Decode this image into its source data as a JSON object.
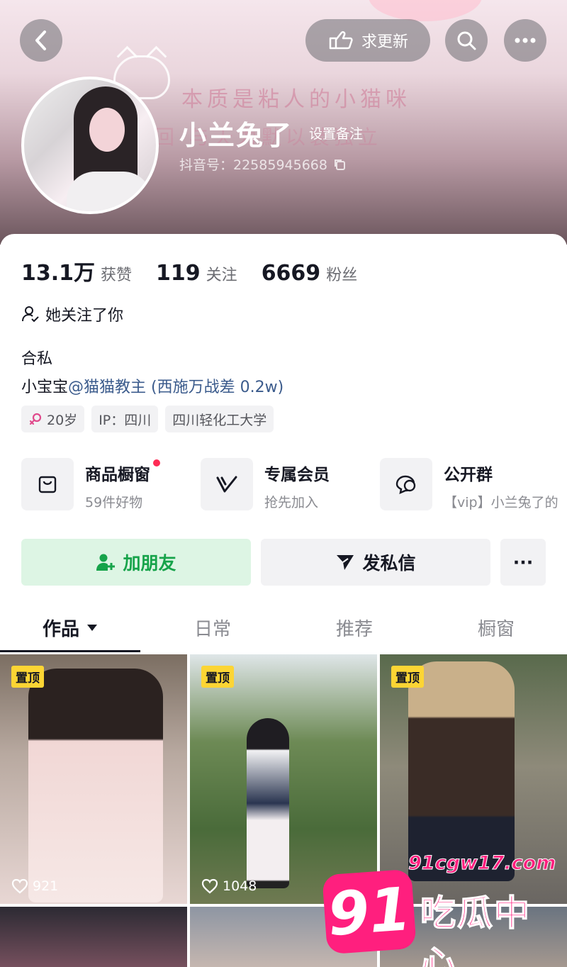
{
  "header": {
    "request_update_label": "求更新",
    "nickname": "小兰兔了",
    "remark_label": "设置备注",
    "douyin_id": "抖音号：22585945668",
    "banner_text_line1": "本质是粘人的小猫咪",
    "banner_text_line2": "回 与天为默以装独立"
  },
  "stats": [
    {
      "value": "13.1万",
      "label": "获赞"
    },
    {
      "value": "119",
      "label": "关注"
    },
    {
      "value": "6669",
      "label": "粉丝"
    }
  ],
  "profile": {
    "follows_you": "她关注了你",
    "bio_line1": "合私",
    "bio_line2_prefix": "小宝宝",
    "bio_line2_mention": "@猫猫教主 (西施万战差 0.2w)",
    "tags": [
      "20岁",
      "IP：四川",
      "四川轻化工大学"
    ]
  },
  "features": [
    {
      "title": "商品橱窗",
      "sub": "59件好物",
      "icon": "shop-bag-icon"
    },
    {
      "title": "专属会员",
      "sub": "抢先加入",
      "icon": "vip-v-icon"
    },
    {
      "title": "公开群",
      "sub": "【vip】小兰兔了的",
      "icon": "chat-bubbles-icon"
    }
  ],
  "actions": {
    "add_friend": "加朋友",
    "message": "发私信",
    "more": "···"
  },
  "tabs": [
    "作品",
    "日常",
    "推荐",
    "橱窗"
  ],
  "videos": [
    {
      "pinned": "置顶",
      "likes": "921"
    },
    {
      "pinned": "置顶",
      "likes": "1048"
    },
    {
      "pinned": "置顶",
      "likes": ""
    }
  ],
  "watermark": {
    "logo": "91",
    "url": "91cgw17.com",
    "text": "吃瓜中心"
  },
  "colors": {
    "accent_green": "#16a34a",
    "notify_red": "#fe2c55",
    "pin_yellow": "#fcd534",
    "watermark_pink": "#ff1f7e",
    "mention_blue": "#3b5b8c"
  }
}
